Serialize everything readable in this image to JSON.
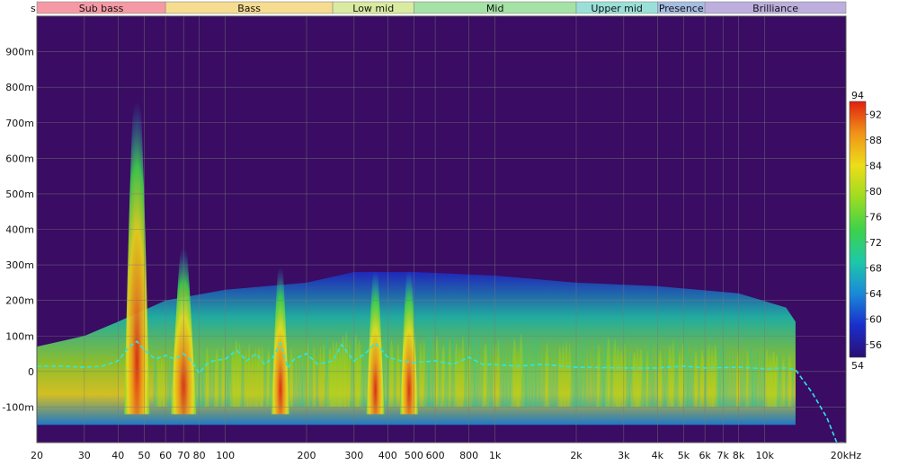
{
  "chart_data": {
    "type": "heatmap",
    "title": "",
    "xlabel": "",
    "ylabel": "s",
    "x_scale": "log",
    "xlim": [
      20,
      20000
    ],
    "ylim": [
      -0.2,
      1.0
    ],
    "x_ticks": [
      {
        "value": 20,
        "label": "20"
      },
      {
        "value": 30,
        "label": "30"
      },
      {
        "value": 40,
        "label": "40"
      },
      {
        "value": 50,
        "label": "50"
      },
      {
        "value": 60,
        "label": "60"
      },
      {
        "value": 70,
        "label": "70"
      },
      {
        "value": 80,
        "label": "80"
      },
      {
        "value": 100,
        "label": "100"
      },
      {
        "value": 200,
        "label": "200"
      },
      {
        "value": 300,
        "label": "300"
      },
      {
        "value": 400,
        "label": "400"
      },
      {
        "value": 500,
        "label": "500"
      },
      {
        "value": 600,
        "label": "600"
      },
      {
        "value": 800,
        "label": "800"
      },
      {
        "value": 1000,
        "label": "1k"
      },
      {
        "value": 2000,
        "label": "2k"
      },
      {
        "value": 3000,
        "label": "3k"
      },
      {
        "value": 4000,
        "label": "4k"
      },
      {
        "value": 5000,
        "label": "5k"
      },
      {
        "value": 6000,
        "label": "6k"
      },
      {
        "value": 7000,
        "label": "7k"
      },
      {
        "value": 8000,
        "label": "8k"
      },
      {
        "value": 10000,
        "label": "10k"
      },
      {
        "value": 20000,
        "label": "20kHz"
      }
    ],
    "y_ticks": [
      {
        "value": -0.1,
        "label": "-100m"
      },
      {
        "value": 0,
        "label": "0"
      },
      {
        "value": 0.1,
        "label": "100m"
      },
      {
        "value": 0.2,
        "label": "200m"
      },
      {
        "value": 0.3,
        "label": "300m"
      },
      {
        "value": 0.4,
        "label": "400m"
      },
      {
        "value": 0.5,
        "label": "500m"
      },
      {
        "value": 0.6,
        "label": "600m"
      },
      {
        "value": 0.7,
        "label": "700m"
      },
      {
        "value": 0.8,
        "label": "800m"
      },
      {
        "value": 0.9,
        "label": "900m"
      }
    ],
    "bands": [
      {
        "name": "Sub bass",
        "from": 20,
        "to": 60,
        "color": "#f59aa4"
      },
      {
        "name": "Bass",
        "from": 60,
        "to": 250,
        "color": "#f6dc90"
      },
      {
        "name": "Low mid",
        "from": 250,
        "to": 500,
        "color": "#d9eba0"
      },
      {
        "name": "Mid",
        "from": 500,
        "to": 2000,
        "color": "#a4e2a6"
      },
      {
        "name": "Upper mid",
        "from": 2000,
        "to": 4000,
        "color": "#9ae0d8"
      },
      {
        "name": "Presence",
        "from": 4000,
        "to": 6000,
        "color": "#a6bde2"
      },
      {
        "name": "Brilliance",
        "from": 6000,
        "to": 20000,
        "color": "#bdaede"
      }
    ],
    "colorbar": {
      "min": 54,
      "max": 94,
      "ticks": [
        56,
        60,
        64,
        68,
        72,
        76,
        80,
        84,
        88,
        92
      ],
      "min_label": "54",
      "max_label": "94",
      "colors": [
        "#2a0f72",
        "#1a2ecc",
        "#1a8ad8",
        "#1ec8a8",
        "#3ed24a",
        "#9cdc22",
        "#eedd18",
        "#f09418",
        "#e02010"
      ]
    },
    "background_color": "#3a0c63",
    "grid": true,
    "peaks": [
      {
        "freq": 47,
        "decay": 0.86,
        "level": 93
      },
      {
        "freq": 70,
        "decay": 0.4,
        "level": 86
      },
      {
        "freq": 160,
        "decay": 0.34,
        "level": 84
      },
      {
        "freq": 360,
        "decay": 0.33,
        "level": 84
      },
      {
        "freq": 480,
        "decay": 0.33,
        "level": 82
      }
    ],
    "envelope": [
      {
        "freq": 20,
        "decay": 0.07
      },
      {
        "freq": 30,
        "decay": 0.1
      },
      {
        "freq": 40,
        "decay": 0.14
      },
      {
        "freq": 60,
        "decay": 0.2
      },
      {
        "freq": 100,
        "decay": 0.23
      },
      {
        "freq": 200,
        "decay": 0.25
      },
      {
        "freq": 300,
        "decay": 0.28
      },
      {
        "freq": 500,
        "decay": 0.28
      },
      {
        "freq": 1000,
        "decay": 0.27
      },
      {
        "freq": 2000,
        "decay": 0.25
      },
      {
        "freq": 4000,
        "decay": 0.24
      },
      {
        "freq": 8000,
        "decay": 0.22
      },
      {
        "freq": 12000,
        "decay": 0.18
      },
      {
        "freq": 13000,
        "decay": 0.14
      }
    ],
    "series": [
      {
        "style": "dashed",
        "color": "#2ee6e6",
        "points": [
          [
            20,
            0.015
          ],
          [
            25,
            0.015
          ],
          [
            30,
            0.012
          ],
          [
            35,
            0.015
          ],
          [
            40,
            0.03
          ],
          [
            44,
            0.07
          ],
          [
            47,
            0.085
          ],
          [
            50,
            0.06
          ],
          [
            55,
            0.035
          ],
          [
            60,
            0.045
          ],
          [
            65,
            0.035
          ],
          [
            70,
            0.05
          ],
          [
            75,
            0.03
          ],
          [
            80,
            -0.005
          ],
          [
            85,
            0.02
          ],
          [
            90,
            0.03
          ],
          [
            100,
            0.035
          ],
          [
            110,
            0.06
          ],
          [
            120,
            0.03
          ],
          [
            130,
            0.05
          ],
          [
            140,
            0.02
          ],
          [
            150,
            0.04
          ],
          [
            160,
            0.08
          ],
          [
            170,
            0.01
          ],
          [
            180,
            0.035
          ],
          [
            200,
            0.05
          ],
          [
            220,
            0.02
          ],
          [
            250,
            0.03
          ],
          [
            270,
            0.075
          ],
          [
            300,
            0.03
          ],
          [
            330,
            0.05
          ],
          [
            360,
            0.08
          ],
          [
            400,
            0.04
          ],
          [
            450,
            0.03
          ],
          [
            500,
            0.025
          ],
          [
            600,
            0.03
          ],
          [
            700,
            0.02
          ],
          [
            800,
            0.04
          ],
          [
            900,
            0.02
          ],
          [
            1000,
            0.02
          ],
          [
            1200,
            0.015
          ],
          [
            1500,
            0.02
          ],
          [
            2000,
            0.012
          ],
          [
            3000,
            0.01
          ],
          [
            4000,
            0.01
          ],
          [
            5000,
            0.015
          ],
          [
            6000,
            0.01
          ],
          [
            8000,
            0.012
          ],
          [
            10000,
            0.008
          ],
          [
            12000,
            0.01
          ],
          [
            13000,
            0.005
          ],
          [
            15000,
            -0.06
          ],
          [
            17000,
            -0.13
          ],
          [
            18500,
            -0.2
          ],
          [
            20000,
            -0.2
          ]
        ]
      }
    ]
  }
}
